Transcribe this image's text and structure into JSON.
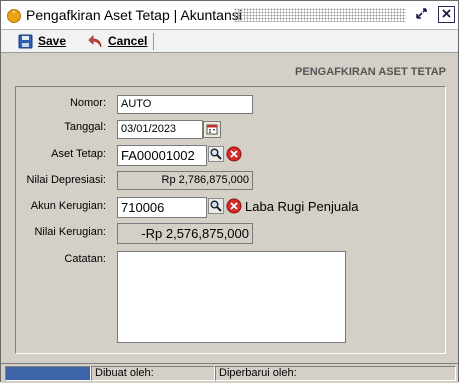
{
  "window": {
    "title": "Pengafkiran Aset Tetap | Akuntansi",
    "title_icon": "chevron-up-circle-icon",
    "restore_icon": "restore-icon",
    "close_icon": "close-icon"
  },
  "toolbar": {
    "save_label": "Save",
    "cancel_label": "Cancel"
  },
  "form": {
    "heading": "PENGAFKIRAN ASET TETAP",
    "nomor_label": "Nomor:",
    "nomor_value": "AUTO",
    "tanggal_label": "Tanggal:",
    "tanggal_value": "03/01/2023",
    "aset_label": "Aset Tetap:",
    "aset_value": "FA00001002",
    "nilai_depresiasi_label": "Nilai Depresiasi:",
    "nilai_depresiasi_value": "Rp 2,786,875,000",
    "akun_label": "Akun Kerugian:",
    "akun_value": "710006",
    "akun_name": "Laba Rugi Penjuala",
    "nilai_kerugian_label": "Nilai Kerugian:",
    "nilai_kerugian_value": "-Rp 2,576,875,000",
    "catatan_label": "Catatan:",
    "catatan_value": ""
  },
  "status": {
    "progress": 1.0,
    "created_label": "Dibuat oleh:",
    "updated_label": "Diperbarui oleh:"
  },
  "colors": {
    "accent": "#3d63a8",
    "delete_red": "#d62b2b",
    "window_bg": "#d4d0c8"
  }
}
